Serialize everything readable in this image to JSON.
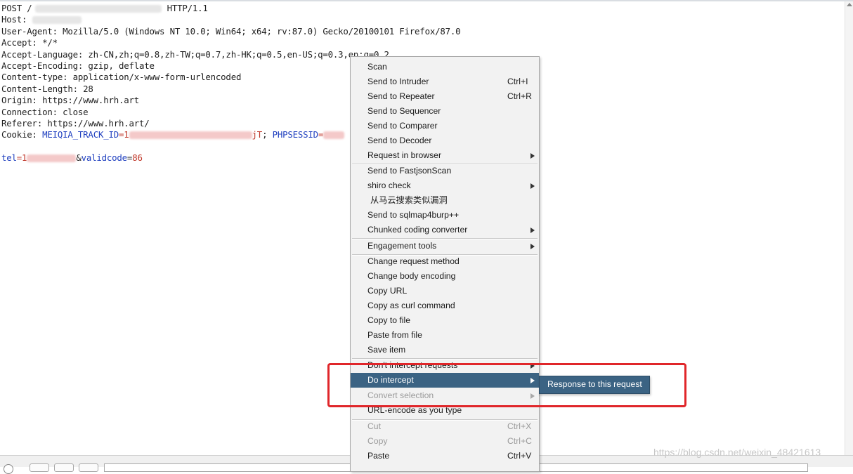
{
  "request": {
    "line1": {
      "method": "POST /",
      "version": "HTTP/1.1"
    },
    "host_label": "Host: ",
    "user_agent": "User-Agent: Mozilla/5.0 (Windows NT 10.0; Win64; x64; rv:87.0) Gecko/20100101 Firefox/87.0",
    "accept": "Accept: */*",
    "accept_language": "Accept-Language: zh-CN,zh;q=0.8,zh-TW;q=0.7,zh-HK;q=0.5,en-US;q=0.3,en;q=0.2",
    "accept_encoding": "Accept-Encoding: gzip, deflate",
    "content_type": "Content-type: application/x-www-form-urlencoded",
    "content_length": "Content-Length: 28",
    "origin": "Origin: https://www.hrh.art",
    "connection": "Connection: close",
    "referer": "Referer: https://www.hrh.art/",
    "cookie": {
      "label": "Cookie: ",
      "name1": "MEIQIA_TRACK_ID",
      "eq1": "=1",
      "tail1": "jT",
      "sep": "; ",
      "name2": "PHPSESSID",
      "eq2": "="
    },
    "body": {
      "name1": "tel",
      "eq1": "=1",
      "amp": "&",
      "name2": "validcode",
      "eq2": "=",
      "value2": "86"
    }
  },
  "context_menu": {
    "items": [
      {
        "label": "Scan"
      },
      {
        "label": "Send to Intruder",
        "shortcut": "Ctrl+I"
      },
      {
        "label": "Send to Repeater",
        "shortcut": "Ctrl+R"
      },
      {
        "label": "Send to Sequencer"
      },
      {
        "label": "Send to Comparer"
      },
      {
        "label": "Send to Decoder"
      },
      {
        "label": "Request in browser"
      },
      {
        "label": "Send to FastjsonScan"
      },
      {
        "label": "shiro check"
      },
      {
        "label": "从马云搜索类似漏洞"
      },
      {
        "label": "Send to sqlmap4burp++"
      },
      {
        "label": "Chunked coding converter"
      },
      {
        "label": "Engagement tools"
      },
      {
        "label": "Change request method"
      },
      {
        "label": "Change body encoding"
      },
      {
        "label": "Copy URL"
      },
      {
        "label": "Copy as curl command"
      },
      {
        "label": "Copy to file"
      },
      {
        "label": "Paste from file"
      },
      {
        "label": "Save item"
      },
      {
        "label": "Don't intercept requests"
      },
      {
        "label": "Do intercept"
      },
      {
        "label": "Convert selection"
      },
      {
        "label": "URL-encode as you type"
      },
      {
        "label": "Cut",
        "shortcut": "Ctrl+X"
      },
      {
        "label": "Copy",
        "shortcut": "Ctrl+C"
      },
      {
        "label": "Paste",
        "shortcut": "Ctrl+V"
      }
    ]
  },
  "submenu": {
    "label": "Response to this request"
  },
  "colors": {
    "highlight": "#3b6383",
    "annotation": "#e0262a",
    "param_name": "#1f3fbf",
    "param_value": "#c0392b"
  },
  "watermark": "https://blog.csdn.net/weixin_48421613"
}
